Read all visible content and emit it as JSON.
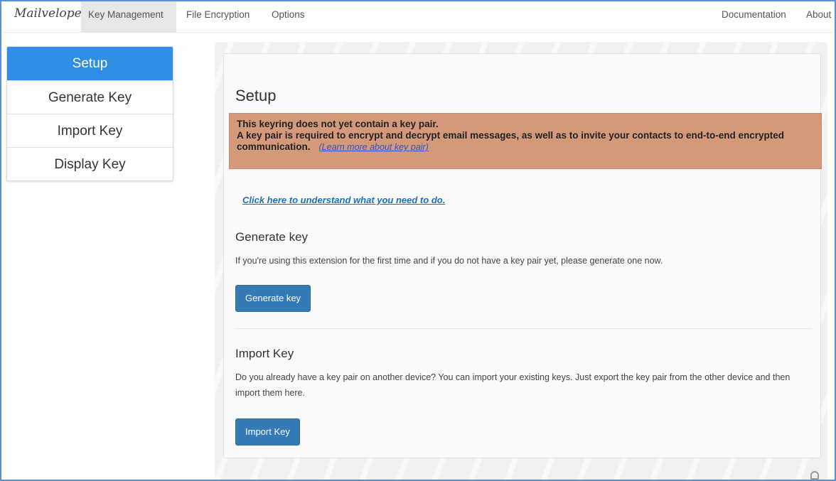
{
  "app": {
    "brand": "Mailvelope"
  },
  "nav": {
    "key_management": "Key Management",
    "file_encryption": "File Encryption",
    "options": "Options",
    "documentation": "Documentation",
    "about": "About"
  },
  "sidebar": {
    "items": [
      {
        "label": "Setup",
        "active": true
      },
      {
        "label": "Generate Key",
        "active": false
      },
      {
        "label": "Import Key",
        "active": false
      },
      {
        "label": "Display Key",
        "active": false
      }
    ]
  },
  "main": {
    "title": "Setup",
    "alert": {
      "line1": "This keyring does not yet contain a key pair.",
      "line2": "A key pair is required to encrypt and decrypt email messages, as well as to invite your contacts to end-to-end encrypted communication.",
      "learn_more": "(Learn more about key pair)",
      "color": "#d4997a"
    },
    "help_link": "Click here to understand what you need to do.",
    "generate": {
      "title": "Generate key",
      "text": "If you're using this extension for the first time and if you do not have a key pair yet, please generate one now.",
      "button": "Generate key"
    },
    "import": {
      "title": "Import Key",
      "text": "Do you already have a key pair on another device? You can import your existing keys. Just export the key pair from the other device and then import them here.",
      "button": "Import Key"
    }
  },
  "colors": {
    "accent": "#2f8ee6",
    "button": "#337ab7",
    "frame_border": "#5b8fd6"
  },
  "icons": {
    "corner": "lock-icon"
  }
}
